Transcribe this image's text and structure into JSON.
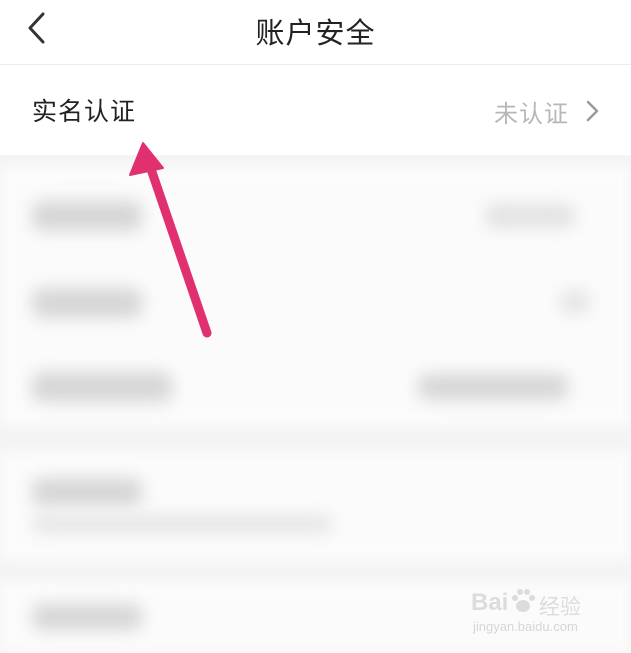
{
  "nav": {
    "title": "账户安全"
  },
  "verify_row": {
    "label": "实名认证",
    "status": "未认证"
  },
  "annotation": {
    "arrow_color": "#e0306f"
  },
  "watermark": {
    "brand": "Bai",
    "jingyan": "经验",
    "url": "jingyan.baidu.com"
  },
  "colors": {
    "background": "#f6f6f6",
    "text_primary": "#222222",
    "text_secondary": "#b7b7b7"
  }
}
